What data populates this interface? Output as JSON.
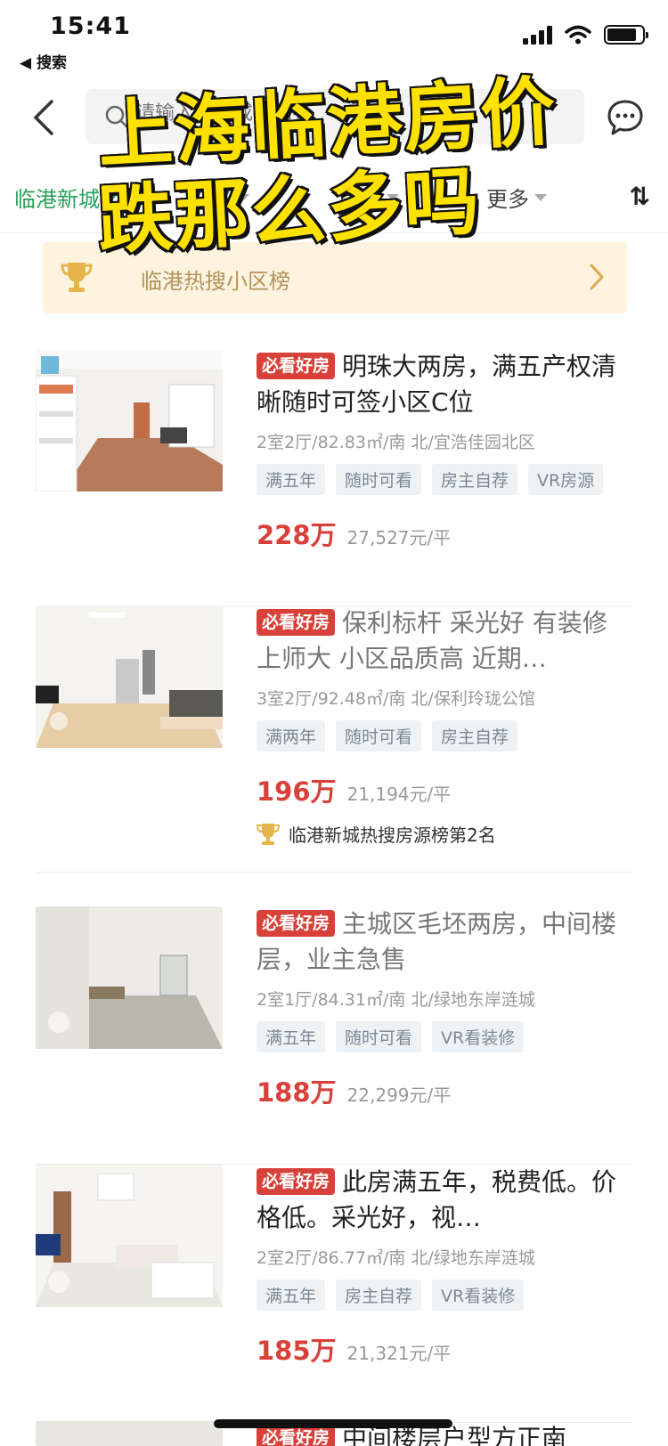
{
  "status_bar": {
    "time": "15:41",
    "back_app": "◀ 搜索"
  },
  "search": {
    "placeholder": "请输入小区或商圈名"
  },
  "filters": [
    {
      "label": "临港新城",
      "active": true
    },
    {
      "label": "价格",
      "active": false
    },
    {
      "label": "房型",
      "active": false
    },
    {
      "label": "更多",
      "active": false
    }
  ],
  "sort_icon": "⇅",
  "banner": {
    "text": "临港热搜小区榜"
  },
  "overlay": {
    "line1": "上海临港房价",
    "line2": "跌那么多吗"
  },
  "listings": [
    {
      "badge": "必看好房",
      "title": "明珠大两房，满五产权清晰随时可签小区C位",
      "meta": "2室2厅/82.83㎡/南 北/宜浩佳园北区",
      "tags": [
        "满五年",
        "随时可看",
        "房主自荐",
        "VR房源"
      ],
      "price": "228万",
      "unit_price": "27,527元/平",
      "hot": ""
    },
    {
      "badge": "必看好房",
      "title": "保利标杆 采光好 有装修 上师大 小区品质高 近期…",
      "meta": "3室2厅/92.48㎡/南 北/保利玲珑公馆",
      "tags": [
        "满两年",
        "随时可看",
        "房主自荐"
      ],
      "price": "196万",
      "unit_price": "21,194元/平",
      "hot": "临港新城热搜房源榜第2名"
    },
    {
      "badge": "必看好房",
      "title": "主城区毛坯两房，中间楼层，业主急售",
      "meta": "2室1厅/84.31㎡/南 北/绿地东岸涟城",
      "tags": [
        "满五年",
        "随时可看",
        "VR看装修"
      ],
      "price": "188万",
      "unit_price": "22,299元/平",
      "hot": ""
    },
    {
      "badge": "必看好房",
      "title": "此房满五年，税费低。价格低。采光好，视…",
      "meta": "2室2厅/86.77㎡/南 北/绿地东岸涟城",
      "tags": [
        "满五年",
        "房主自荐",
        "VR看装修"
      ],
      "price": "185万",
      "unit_price": "21,321元/平",
      "hot": ""
    },
    {
      "badge": "必看好房",
      "title": "中间楼层户型方正南",
      "meta": "",
      "tags": [],
      "price": "",
      "unit_price": "",
      "hot": ""
    }
  ],
  "colors": {
    "accent_green": "#27a35a",
    "price_red": "#d8413a",
    "overlay_yellow": "#ffe100"
  }
}
